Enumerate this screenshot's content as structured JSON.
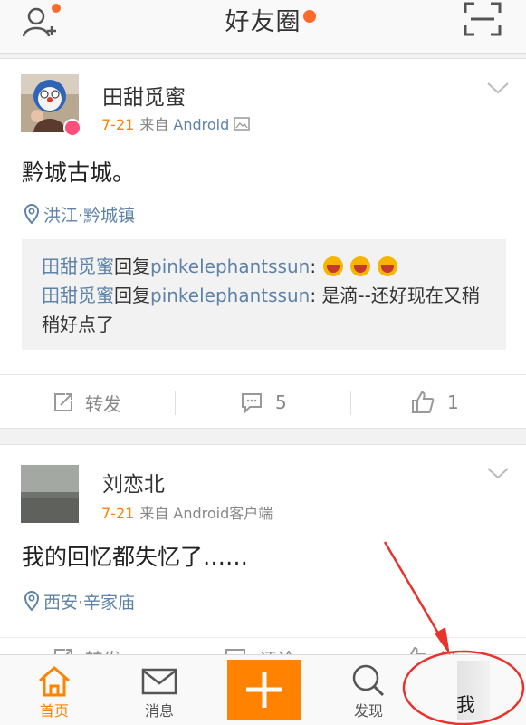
{
  "header": {
    "title": "好友圈",
    "add_friend_icon": "add-friend-icon",
    "scan_icon": "scan-icon"
  },
  "colors": {
    "accent": "#ff8200",
    "link": "#5e82a8",
    "annotation": "#e8322c"
  },
  "posts": [
    {
      "author": "田甜觅蜜",
      "date": "7-21",
      "source_prefix": "来自",
      "source": "Android",
      "text": "黔城古城。",
      "location": "洪江·黔城镇",
      "comments": [
        {
          "from": "田甜觅蜜",
          "verb": "回复",
          "to": "pinkelephantssun",
          "text": ":"
        },
        {
          "from": "田甜觅蜜",
          "verb": "回复",
          "to": "pinkelephantssun",
          "text": ": 是滴--还好现在又稍稍好点了"
        }
      ],
      "actions": {
        "repost": "转发",
        "comment_count": "5",
        "like_count": "1"
      }
    },
    {
      "author": "刘恋北",
      "date": "7-21",
      "source_prefix": "来自",
      "source": "Android客户端",
      "text": "我的回忆都失忆了……",
      "location": "西安·辛家庙",
      "actions": {
        "repost": "转发",
        "comment": "评论",
        "like": "赞"
      }
    }
  ],
  "tabbar": {
    "home": "首页",
    "messages": "消息",
    "discover": "发现",
    "me": "我"
  }
}
